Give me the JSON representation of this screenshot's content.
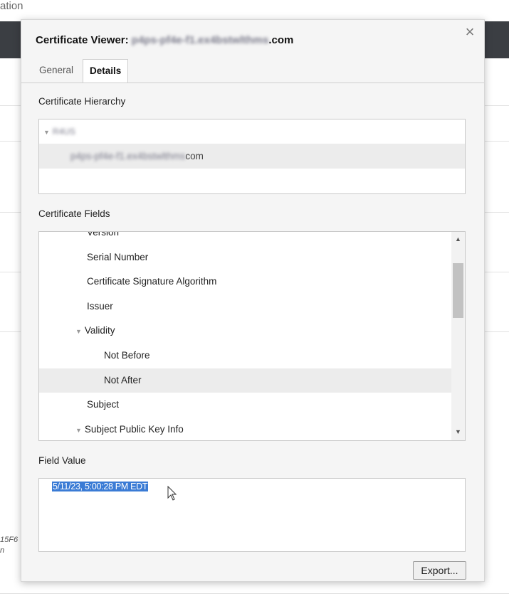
{
  "background": {
    "title_fragment": "ation",
    "side_text_1": "15F6",
    "side_text_2": "n"
  },
  "dialog": {
    "title_prefix": "Certificate Viewer: ",
    "title_host_redacted": "p4ps-pf4e-f1.ex4bstwlthms",
    "title_suffix": ".com",
    "close_glyph": "×",
    "tabs": [
      {
        "label": "General",
        "active": false
      },
      {
        "label": "Details",
        "active": true
      }
    ],
    "hierarchy": {
      "label": "Certificate Hierarchy",
      "root_redacted": "R4US",
      "leaf_redacted": "p4ps-pf4e-f1.ex4bstwlthms",
      "leaf_suffix": "com"
    },
    "fields": {
      "label": "Certificate Fields",
      "items": [
        {
          "label": "Version",
          "indent": 1,
          "expandable": false,
          "selected": false
        },
        {
          "label": "Serial Number",
          "indent": 1,
          "expandable": false,
          "selected": false
        },
        {
          "label": "Certificate Signature Algorithm",
          "indent": 1,
          "expandable": false,
          "selected": false
        },
        {
          "label": "Issuer",
          "indent": 1,
          "expandable": false,
          "selected": false
        },
        {
          "label": "Validity",
          "indent": 1,
          "expandable": true,
          "selected": false
        },
        {
          "label": "Not Before",
          "indent": 2,
          "expandable": false,
          "selected": false
        },
        {
          "label": "Not After",
          "indent": 2,
          "expandable": false,
          "selected": true
        },
        {
          "label": "Subject",
          "indent": 1,
          "expandable": false,
          "selected": false
        },
        {
          "label": "Subject Public Key Info",
          "indent": 1,
          "expandable": true,
          "selected": false
        }
      ]
    },
    "field_value": {
      "label": "Field Value",
      "value": "5/11/23, 5:00:28 PM EDT"
    },
    "export_label": "Export...",
    "colors": {
      "selection": "#3a7bd5",
      "selected_row": "#ececec",
      "dialog_bg": "#f5f5f5",
      "topbar": "#3b3e43"
    }
  }
}
